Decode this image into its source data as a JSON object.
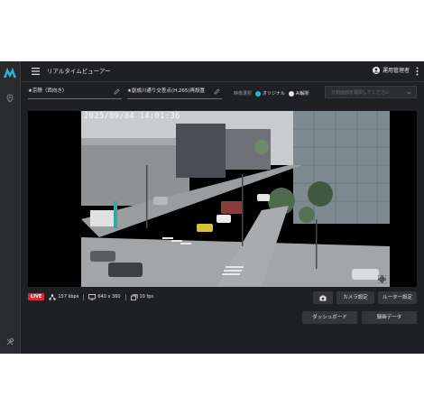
{
  "app": {
    "title": "リアルタイムビューアー",
    "accent": "#27b4d6"
  },
  "user": {
    "name": "運用管理者"
  },
  "toolbar": {
    "camera_name": "★京際（西向き）",
    "location_name": "★創成川通り交差点(H.265)再設置",
    "segment_label": "映像選択",
    "option_original": "オリジナル",
    "option_ai": "AI解析",
    "selected_option": "オリジナル",
    "split_placeholder": "分割画面を選択してください"
  },
  "video": {
    "timestamp": "2025/09/04 14:01:36"
  },
  "stats": {
    "live": "LIVE",
    "bitrate": "157 kbps",
    "resolution": "640 x 360",
    "fps": "10 fps"
  },
  "buttons": {
    "camera_settings": "カメラ設定",
    "router_settings": "ルーター設定",
    "dashboard": "ダッシュボード",
    "recording_data": "録画データ"
  },
  "icons": {
    "logo": "brand-logo-icon",
    "sidebar_top": "location-pin-icon",
    "sidebar_bottom": "wrench-icon",
    "menu": "menu-icon",
    "user": "user-icon",
    "kebab": "kebab-menu-icon",
    "edit": "edit-icon",
    "caret": "chevron-down-icon",
    "expand": "expand-icon",
    "bitrate": "network-icon",
    "resolution": "monitor-icon",
    "fps": "frames-icon",
    "snapshot": "camera-icon"
  }
}
